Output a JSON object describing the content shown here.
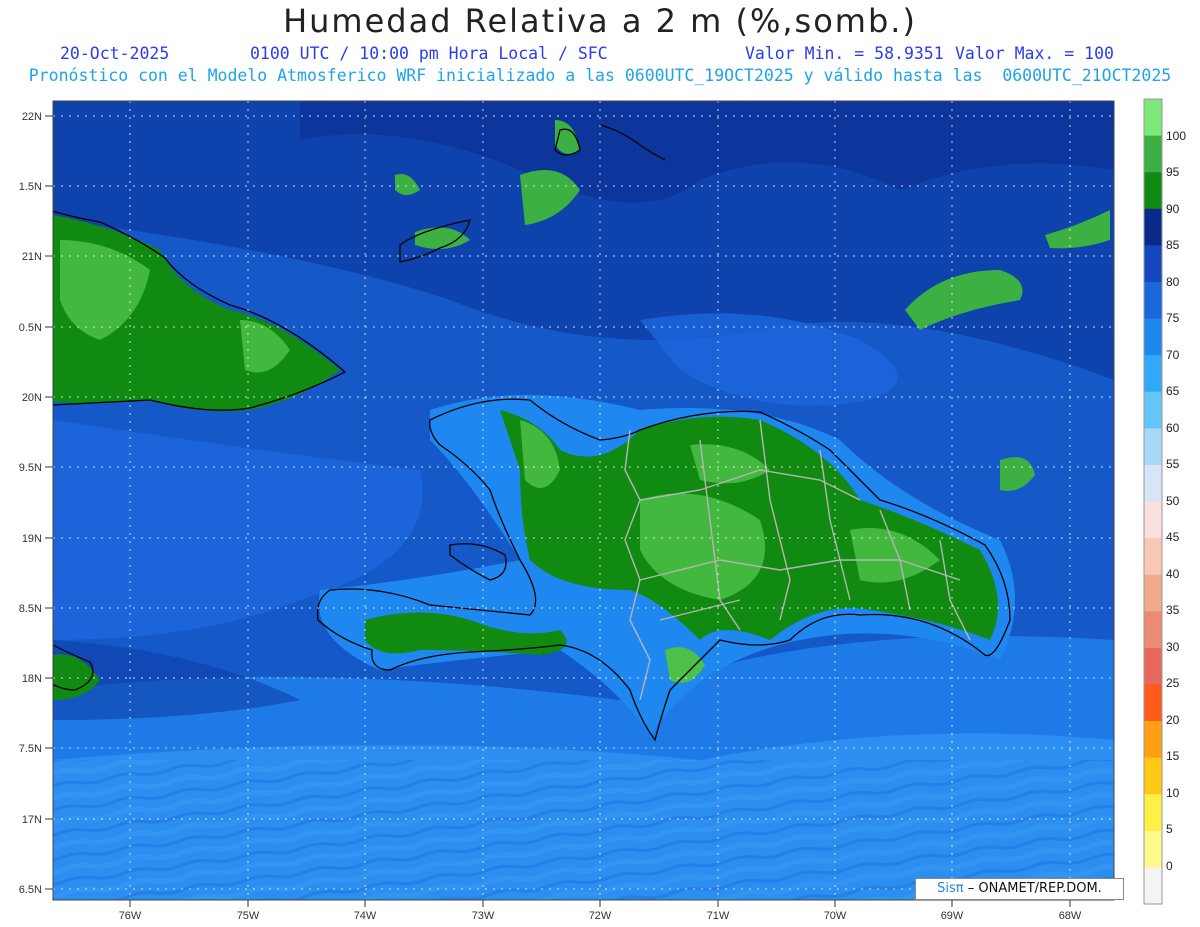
{
  "header": {
    "title": "Humedad Relativa a 2 m (%,somb.)",
    "date": "20-Oct-2025",
    "time": "0100 UTC / 10:00 pm Hora Local / SFC",
    "min": "Valor Min. = 58.9351",
    "max": "Valor Max. = 100",
    "model_line": "Pronóstico con el Modelo Atmosferico WRF inicializado a las 0600UTC_19OCT2025 y válido hasta las  0600UTC_21OCT2025"
  },
  "axes": {
    "lat_labels": [
      "22N",
      "1.5N",
      "21N",
      "0.5N",
      "20N",
      "9.5N",
      "19N",
      "8.5N",
      "18N",
      "7.5N",
      "17N",
      "6.5N"
    ],
    "lon_labels": [
      "76W",
      "75W",
      "74W",
      "73W",
      "72W",
      "71W",
      "70W",
      "69W",
      "68W"
    ]
  },
  "colorbar": {
    "labels": [
      "100",
      "95",
      "90",
      "85",
      "80",
      "75",
      "70",
      "65",
      "60",
      "55",
      "50",
      "45",
      "40",
      "35",
      "30",
      "25",
      "20",
      "15",
      "10",
      "5",
      "0"
    ],
    "colors": [
      "#7de87a",
      "#3cb043",
      "#108a10",
      "#0a2a8a",
      "#1446c0",
      "#1c66dc",
      "#1e88f0",
      "#32a8f8",
      "#64c6f8",
      "#a8d8f8",
      "#d8e4f8",
      "#fbe0e0",
      "#f7c8b4",
      "#f0aa8c",
      "#ec8c78",
      "#e86860",
      "#ff5a1a",
      "#ffa014",
      "#ffc814",
      "#fff046",
      "#fff88a",
      "#f4f4f4"
    ]
  },
  "palette": {
    "ocean_dark": "#0d3fa8",
    "ocean_mid": "#1558c8",
    "ocean_light": "#1e7ae6",
    "ocean_lighter": "#2b8ef0",
    "land_green": "#108a10",
    "land_light_green": "#4cc048",
    "coast": "#000000",
    "borders": "#aaaaaa",
    "grid": "#ffffff"
  },
  "credit": {
    "sis": "Sisπ",
    "rest": "– ONAMET/REP.DOM."
  }
}
